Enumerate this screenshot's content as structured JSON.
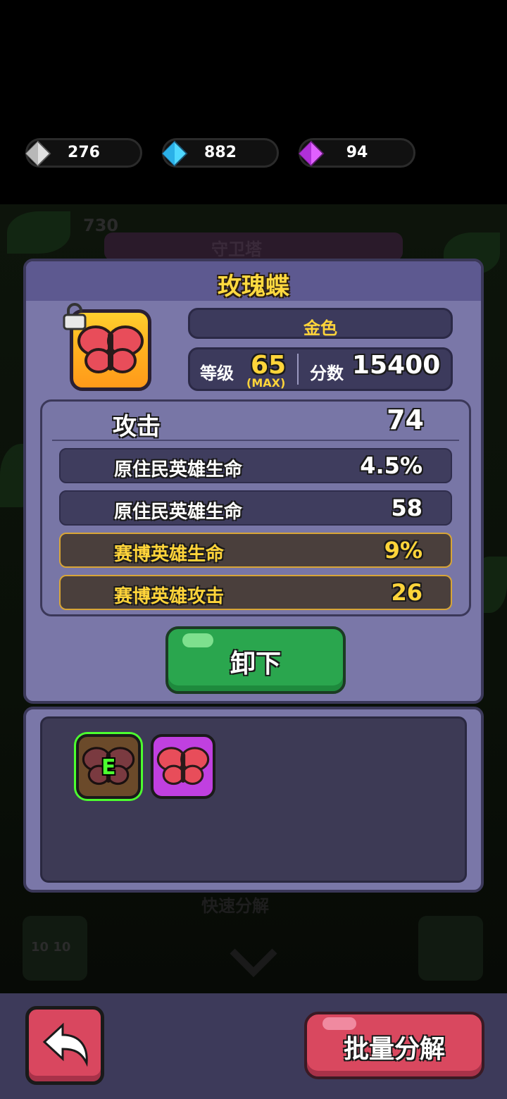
{
  "currency": [
    {
      "icon": "silver-gem-icon",
      "value": "276"
    },
    {
      "icon": "blue-diamond-icon",
      "value": "882"
    },
    {
      "icon": "purple-gem-icon",
      "value": "94"
    }
  ],
  "background": {
    "number": "730",
    "obscured_title": "守卫塔",
    "bottom_text": "快速分解",
    "counter": "10 10"
  },
  "item": {
    "name": "玫瑰蝶",
    "icon": "butterfly-icon",
    "rarity": "金色",
    "level_label": "等级",
    "level": "65",
    "level_max": "(MAX)",
    "score_label": "分数",
    "score": "15400"
  },
  "stats": {
    "main": {
      "label": "攻击",
      "value": "74"
    },
    "rows": [
      {
        "label": "原住民英雄生命",
        "value": "4.5%",
        "tier": "normal"
      },
      {
        "label": "原住民英雄生命",
        "value": "58",
        "tier": "normal"
      },
      {
        "label": "赛博英雄生命",
        "value": "9%",
        "tier": "gold"
      },
      {
        "label": "赛博英雄攻击",
        "value": "26",
        "tier": "gold"
      }
    ]
  },
  "actions": {
    "unequip": "卸下",
    "decompose": "批量分解"
  },
  "inventory": {
    "equipped_badge": "E"
  },
  "colors": {
    "gold": "#ffd43a",
    "green_button": "#2aa64e",
    "red_button": "#d9475f",
    "panel": "#7a77a8"
  }
}
